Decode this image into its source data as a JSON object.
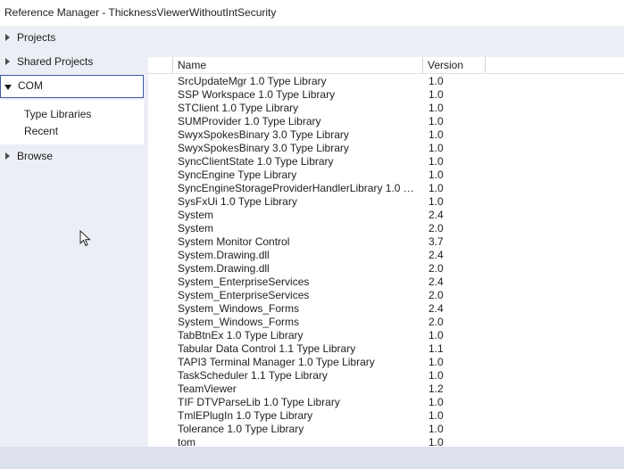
{
  "window": {
    "title": "Reference Manager - ThicknessViewerWithoutIntSecurity"
  },
  "nav": {
    "items": [
      {
        "label": "Projects",
        "expanded": false
      },
      {
        "label": "Shared Projects",
        "expanded": false
      },
      {
        "label": "COM",
        "expanded": true
      },
      {
        "label": "Browse",
        "expanded": false
      }
    ],
    "com_subitems": [
      "Type Libraries",
      "Recent"
    ]
  },
  "table": {
    "columns": [
      "Name",
      "Version"
    ],
    "rows": [
      {
        "name": "SrcUpdateMgr 1.0 Type Library",
        "version": "1.0"
      },
      {
        "name": "SSP Workspace 1.0 Type Library",
        "version": "1.0"
      },
      {
        "name": "STClient 1.0 Type Library",
        "version": "1.0"
      },
      {
        "name": "SUMProvider 1.0 Type Library",
        "version": "1.0"
      },
      {
        "name": "SwyxSpokesBinary 3.0 Type Library",
        "version": "1.0"
      },
      {
        "name": "SwyxSpokesBinary 3.0 Type Library",
        "version": "1.0"
      },
      {
        "name": "SyncClientState 1.0 Type Library",
        "version": "1.0"
      },
      {
        "name": "SyncEngine Type Library",
        "version": "1.0"
      },
      {
        "name": "SyncEngineStorageProviderHandlerLibrary 1.0 Ty...",
        "version": "1.0"
      },
      {
        "name": "SysFxUi 1.0 Type Library",
        "version": "1.0"
      },
      {
        "name": "System",
        "version": "2.4"
      },
      {
        "name": "System",
        "version": "2.0"
      },
      {
        "name": "System Monitor Control",
        "version": "3.7"
      },
      {
        "name": "System.Drawing.dll",
        "version": "2.4"
      },
      {
        "name": "System.Drawing.dll",
        "version": "2.0"
      },
      {
        "name": "System_EnterpriseServices",
        "version": "2.4"
      },
      {
        "name": "System_EnterpriseServices",
        "version": "2.0"
      },
      {
        "name": "System_Windows_Forms",
        "version": "2.4"
      },
      {
        "name": "System_Windows_Forms",
        "version": "2.0"
      },
      {
        "name": "TabBtnEx 1.0 Type Library",
        "version": "1.0"
      },
      {
        "name": "Tabular Data Control 1.1 Type Library",
        "version": "1.1"
      },
      {
        "name": "TAPI3 Terminal Manager 1.0 Type Library",
        "version": "1.0"
      },
      {
        "name": "TaskScheduler 1.1 Type Library",
        "version": "1.0"
      },
      {
        "name": "TeamViewer",
        "version": "1.2"
      },
      {
        "name": "TIF DTVParseLib 1.0 Type Library",
        "version": "1.0"
      },
      {
        "name": "TmlEPlugIn 1.0 Type Library",
        "version": "1.0"
      },
      {
        "name": "Tolerance 1.0 Type Library",
        "version": "1.0"
      },
      {
        "name": "tom",
        "version": "1.0"
      }
    ]
  },
  "icons": {
    "collapsed": "triangle-right-icon",
    "expanded": "triangle-down-icon",
    "cursor": "mouse-pointer-icon"
  },
  "colors": {
    "selection_border": "#3b5aa5",
    "background": "#eceef6"
  }
}
